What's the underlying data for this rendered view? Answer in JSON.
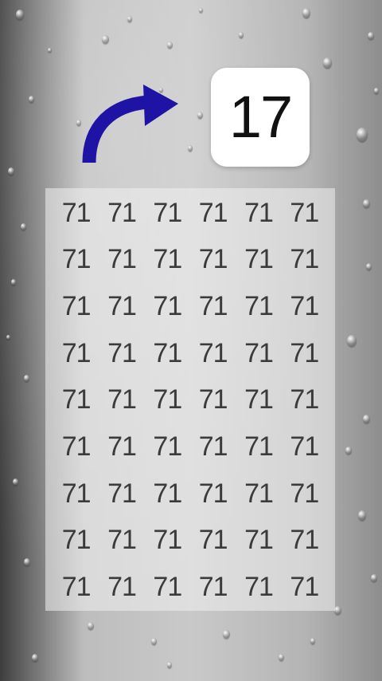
{
  "target": {
    "value": "17"
  },
  "grid": {
    "rows": [
      [
        "71",
        "71",
        "71",
        "71",
        "71",
        "71"
      ],
      [
        "71",
        "71",
        "71",
        "71",
        "71",
        "71"
      ],
      [
        "71",
        "71",
        "71",
        "71",
        "71",
        "71"
      ],
      [
        "71",
        "71",
        "71",
        "71",
        "71",
        "71"
      ],
      [
        "71",
        "71",
        "71",
        "71",
        "71",
        "71"
      ],
      [
        "71",
        "71",
        "71",
        "71",
        "71",
        "71"
      ],
      [
        "71",
        "71",
        "71",
        "71",
        "71",
        "71"
      ],
      [
        "71",
        "71",
        "71",
        "71",
        "71",
        "71"
      ],
      [
        "71",
        "71",
        "71",
        "71",
        "71",
        "71"
      ]
    ]
  },
  "arrow": {
    "icon": "curved-arrow-right-icon",
    "color": "#1f13a6"
  }
}
